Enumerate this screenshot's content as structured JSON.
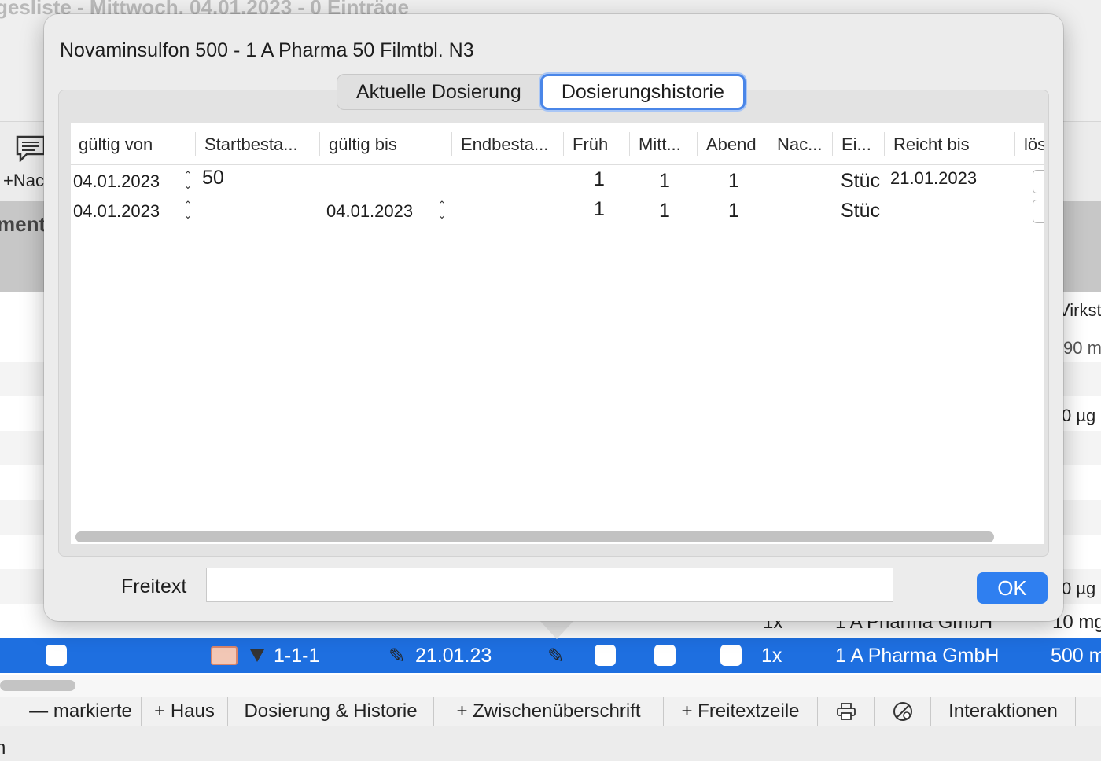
{
  "background": {
    "window_title": "gesliste - Mittwoch, 04.01.2023 - 0 Einträge",
    "toolbar_button_label": "+Nac",
    "section_label": "mente",
    "right_column_header": "Virkst",
    "right_cells": [
      "90 m",
      "0 µg",
      "0 µg",
      "10 mg",
      "500 m"
    ],
    "partial_row": {
      "count": "1x",
      "manufacturer": "1 A Pharma GmbH"
    },
    "selected_row": {
      "scheme": "1-1-1",
      "date": "21.01.23",
      "count": "1x",
      "manufacturer": "1 A Pharma GmbH",
      "strength": "500 m"
    },
    "bottom_bar": {
      "remove_marked": "— markierte",
      "add_house": "+ Haus",
      "dosage_history": "Dosierung & Historie",
      "add_subheading": "+  Zwischenüberschrift",
      "add_freetext_line": "+  Freitextzeile",
      "print_icon": "printer-icon",
      "safety_icon": "pill-check-icon",
      "interactions": "Interaktionen"
    },
    "status_text": "n"
  },
  "dialog": {
    "title": "Novaminsulfon 500 - 1 A Pharma 50 Filmtbl. N3",
    "tabs": [
      {
        "label": "Aktuelle Dosierung",
        "active": false
      },
      {
        "label": "Dosierungshistorie",
        "active": true
      }
    ],
    "table": {
      "columns": [
        "gültig von",
        "Startbesta...",
        "gültig bis",
        "Endbesta...",
        "Früh",
        "Mitt...",
        "Abend",
        "Nac...",
        "Ei...",
        "Reicht bis",
        "lös"
      ],
      "rows": [
        {
          "valid_from": "04.01.2023",
          "start_stock": "50",
          "valid_to": "",
          "end_stock": "",
          "morning": "1",
          "noon": "1",
          "evening": "1",
          "night": "",
          "unit": "Stüc",
          "lasts_until": "21.01.2023"
        },
        {
          "valid_from": "04.01.2023",
          "start_stock": "",
          "valid_to": "04.01.2023",
          "end_stock": "",
          "morning": "1",
          "noon": "1",
          "evening": "1",
          "night": "",
          "unit": "Stüc",
          "lasts_until": ""
        }
      ]
    },
    "freitext_label": "Freitext",
    "freitext_value": "",
    "ok_label": "OK"
  }
}
